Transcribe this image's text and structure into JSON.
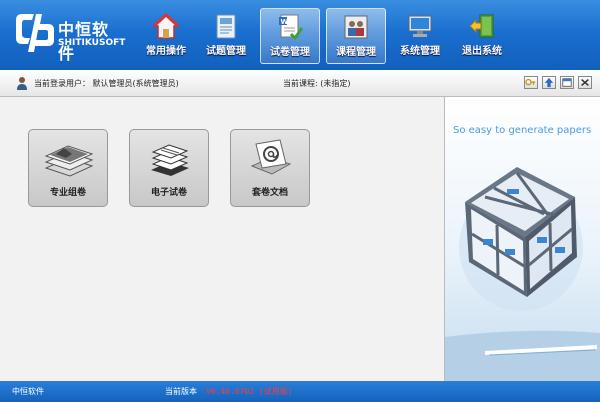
{
  "brand": {
    "name_cn": "中恒软件",
    "name_en": "SHITIKUSOFT"
  },
  "nav": [
    {
      "label": "常用操作",
      "icon": "home-icon"
    },
    {
      "label": "试题管理",
      "icon": "question-book-icon"
    },
    {
      "label": "试卷管理",
      "icon": "exam-paper-icon",
      "active": true
    },
    {
      "label": "课程管理",
      "icon": "course-people-icon",
      "active": true
    },
    {
      "label": "系统管理",
      "icon": "computer-icon"
    },
    {
      "label": "退出系统",
      "icon": "exit-door-icon"
    }
  ],
  "infobar": {
    "user": "当前登录用户： 默认管理员(系统管理员)",
    "course": "当前课程: (未指定)"
  },
  "toolbar_icons": [
    "key-icon",
    "up-arrow-icon",
    "window-icon",
    "close-icon"
  ],
  "tiles": [
    {
      "label": "专业组卷",
      "icon": "paper-stack-icon"
    },
    {
      "label": "电子试卷",
      "icon": "electronic-paper-icon"
    },
    {
      "label": "套卷文档",
      "icon": "at-document-icon"
    }
  ],
  "side_banner": {
    "tagline": "So easy to generate papers"
  },
  "statusbar": {
    "company": "中恒软件",
    "version_label": "当前版本",
    "version": "V6.46.0702 (试用版)"
  },
  "colors": {
    "accent": "#1a6fcf",
    "version_red": "#ff3a3a"
  }
}
